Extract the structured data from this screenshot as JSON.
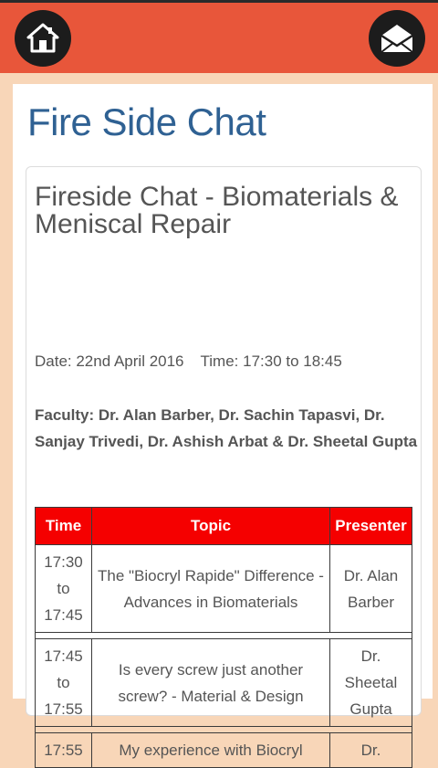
{
  "header": {
    "home_icon": "home-icon",
    "mail_icon": "envelope-icon",
    "colors": {
      "bar": "#e8563a",
      "button": "#1c1c1c"
    }
  },
  "page": {
    "title": "Fire Side Chat"
  },
  "event": {
    "title": "Fireside Chat - Biomaterials & Meniscal Repair",
    "date": "Date: 22nd April 2016",
    "time": "Time: 17:30 to 18:45",
    "faculty": "Faculty: Dr. Alan Barber, Dr. Sachin Tapasvi, Dr. Sanjay Trivedi, Dr. Ashish Arbat & Dr. Sheetal Gupta"
  },
  "schedule": {
    "headers": [
      "Time",
      "Topic",
      "Presenter"
    ],
    "rows": [
      {
        "time_start": "17:30",
        "time_to": "to",
        "time_end": "17:45",
        "topic": "The \"Biocryl Rapide\" Difference - Advances in Biomaterials",
        "presenter": "Dr. Alan Barber"
      },
      {
        "time_start": "17:45",
        "time_to": "to",
        "time_end": "17:55",
        "topic": "Is every screw just another screw? - Material & Design",
        "presenter": "Dr. Sheetal Gupta"
      },
      {
        "time_start": "17:55",
        "time_to": "",
        "time_end": "",
        "topic": "My experience with Biocryl",
        "presenter": "Dr."
      }
    ]
  }
}
